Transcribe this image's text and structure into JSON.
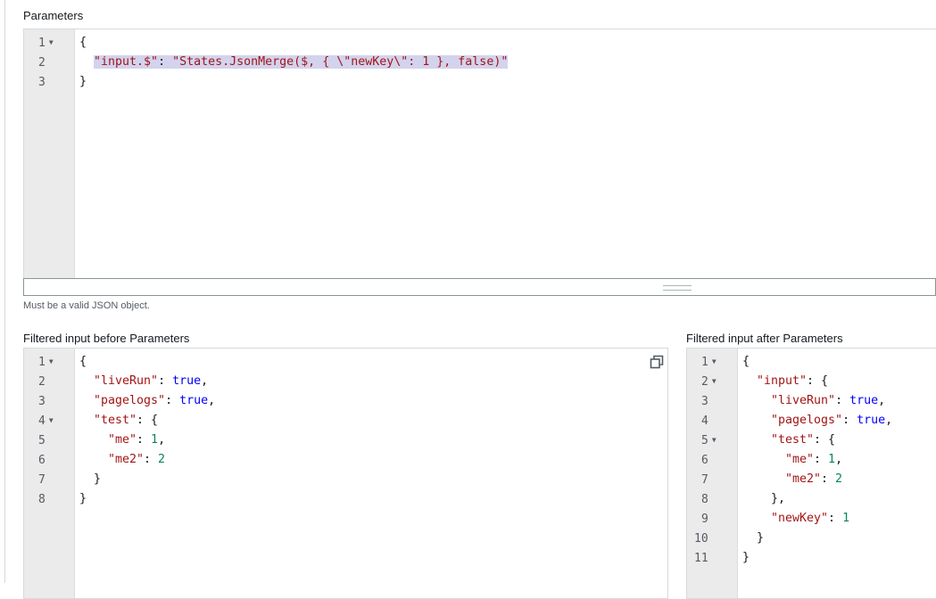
{
  "parameters": {
    "label": "Parameters",
    "hint": "Must be a valid JSON object.",
    "lines": [
      "1",
      "2",
      "3"
    ],
    "code": {
      "open": "{",
      "key": "\"input.$\"",
      "colon": ": ",
      "value": "\"States.JsonMerge($, { \\\"newKey\\\": 1 }, false)\"",
      "close": "}"
    }
  },
  "before": {
    "label": "Filtered input before Parameters",
    "lines": [
      "1",
      "2",
      "3",
      "4",
      "5",
      "6",
      "7",
      "8"
    ],
    "code": {
      "l1": "{",
      "k_liveRun": "\"liveRun\"",
      "v_liveRun": "true",
      "k_pagelogs": "\"pagelogs\"",
      "v_pagelogs": "true",
      "k_test": "\"test\"",
      "k_me": "\"me\"",
      "v_me": "1",
      "k_me2": "\"me2\"",
      "v_me2": "2",
      "close_inner": "}",
      "close_outer": "}"
    }
  },
  "after": {
    "label": "Filtered input after Parameters",
    "lines": [
      "1",
      "2",
      "3",
      "4",
      "5",
      "6",
      "7",
      "8",
      "9",
      "10",
      "11"
    ],
    "code": {
      "l1": "{",
      "k_input": "\"input\"",
      "k_liveRun": "\"liveRun\"",
      "v_liveRun": "true",
      "k_pagelogs": "\"pagelogs\"",
      "v_pagelogs": "true",
      "k_test": "\"test\"",
      "k_me": "\"me\"",
      "v_me": "1",
      "k_me2": "\"me2\"",
      "v_me2": "2",
      "close_test": "},",
      "k_newKey": "\"newKey\"",
      "v_newKey": "1",
      "close_input": "}",
      "close_outer": "}"
    }
  },
  "icons": {
    "copy": "copy-icon",
    "fold": "fold-arrow-icon",
    "resize": "resize-grip-icon"
  }
}
